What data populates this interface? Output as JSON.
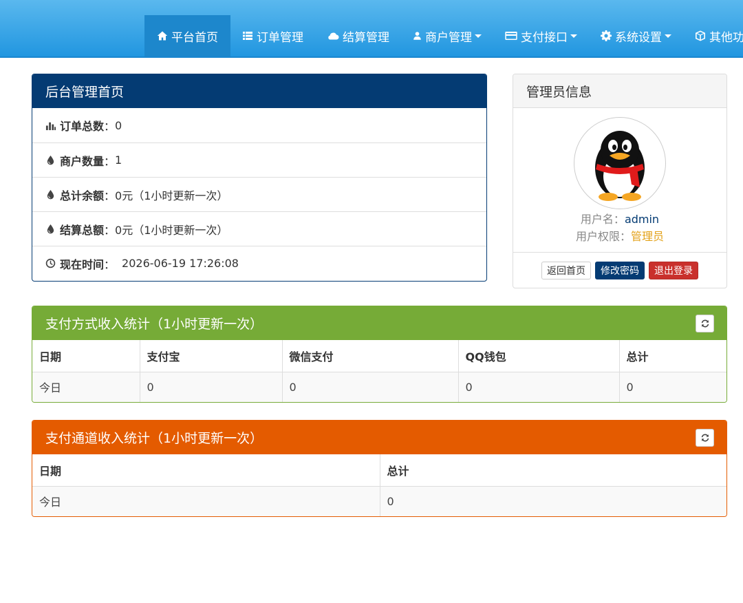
{
  "nav": {
    "items": [
      {
        "label": "平台首页",
        "icon": "home-icon",
        "active": true,
        "dropdown": false
      },
      {
        "label": "订单管理",
        "icon": "list-icon",
        "active": false,
        "dropdown": false
      },
      {
        "label": "结算管理",
        "icon": "cloud-icon",
        "active": false,
        "dropdown": false
      },
      {
        "label": "商户管理",
        "icon": "user-icon",
        "active": false,
        "dropdown": true
      },
      {
        "label": "支付接口",
        "icon": "credit-card-icon",
        "active": false,
        "dropdown": true
      },
      {
        "label": "系统设置",
        "icon": "gear-icon",
        "active": false,
        "dropdown": true
      },
      {
        "label": "其他功能",
        "icon": "cube-icon",
        "active": false,
        "dropdown": true
      }
    ]
  },
  "overview": {
    "title": "后台管理首页",
    "rows": [
      {
        "label": "订单总数",
        "sep": "：",
        "value": "0"
      },
      {
        "label": "商户数量",
        "sep": "：",
        "value": "1"
      },
      {
        "label": "总计余额",
        "sep": "：",
        "value": "0元（1小时更新一次）"
      },
      {
        "label": "结算总额",
        "sep": "：",
        "value": "0元（1小时更新一次）"
      },
      {
        "label": "现在时间",
        "sep": "：",
        "value": "2026-06-19 17:26:08"
      }
    ]
  },
  "admin": {
    "title": "管理员信息",
    "username_label": "用户名：",
    "username": "admin",
    "role_label": "用户权限：",
    "role": "管理员",
    "btn_home": "返回首页",
    "btn_password": "修改密码",
    "btn_logout": "退出登录"
  },
  "pay_method": {
    "title": "支付方式收入统计（1小时更新一次）",
    "headers": [
      "日期",
      "支付宝",
      "微信支付",
      "QQ钱包",
      "总计"
    ],
    "rows": [
      [
        "今日",
        "0",
        "0",
        "0",
        "0"
      ]
    ]
  },
  "pay_channel": {
    "title": "支付通道收入统计（1小时更新一次）",
    "headers": [
      "日期",
      "总计"
    ],
    "rows": [
      [
        "今日",
        "0"
      ]
    ]
  },
  "colors": {
    "nav_top": "#5ab8ee",
    "nav_bottom": "#2196e0",
    "primary": "#043b73",
    "success": "#76ab37",
    "warning": "#e45b00",
    "danger": "#c9302c",
    "role": "#e3a21a"
  }
}
